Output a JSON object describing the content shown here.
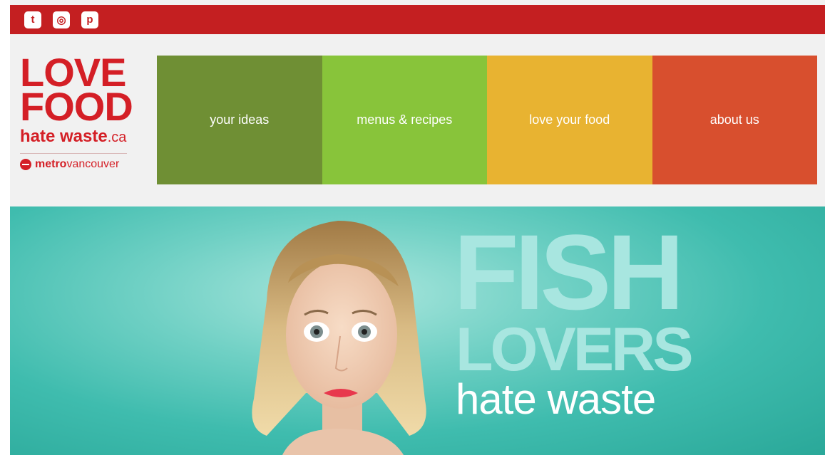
{
  "social": {
    "twitter_icon": "twitter-icon",
    "instagram_icon": "instagram-icon",
    "pinterest_icon": "pinterest-icon",
    "twitter_glyph": "t",
    "instagram_glyph": "◎",
    "pinterest_glyph": "p"
  },
  "logo": {
    "line1": "LOVE",
    "line2": "FOOD",
    "line3": "hate waste",
    "line3_suffix": ".ca",
    "partner_bold": "metro",
    "partner_rest": "vancouver"
  },
  "nav": {
    "items": [
      {
        "label": "your ideas",
        "color": "#6f8f34"
      },
      {
        "label": "menus & recipes",
        "color": "#88c43a"
      },
      {
        "label": "love your food",
        "color": "#e8b331"
      },
      {
        "label": "about us",
        "color": "#d84f2e"
      }
    ]
  },
  "hero": {
    "headline1": "FISH",
    "headline2": "LOVERS",
    "headline3": "hate waste"
  },
  "colors": {
    "brand_red": "#c41f21",
    "logo_red": "#d41f26",
    "hero_teal": "#3fbcae"
  }
}
